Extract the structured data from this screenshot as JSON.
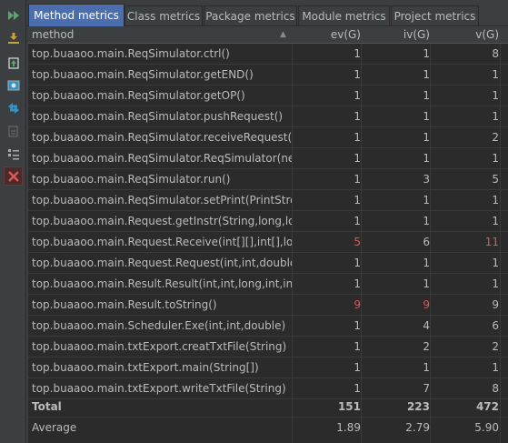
{
  "tabs": [
    {
      "label": "Method metrics",
      "active": true
    },
    {
      "label": "Class metrics",
      "active": false
    },
    {
      "label": "Package metrics",
      "active": false
    },
    {
      "label": "Module metrics",
      "active": false
    },
    {
      "label": "Project metrics",
      "active": false
    }
  ],
  "toolbar": {
    "icons": [
      "run-icon",
      "export-icon",
      "open-file-icon",
      "snapshot-icon",
      "diff-icon",
      "settings-icon",
      "layout-icon",
      "close-icon"
    ]
  },
  "columns": {
    "method": "method",
    "ev": "ev(G)",
    "iv": "iv(G)",
    "v": "v(G)",
    "sort_indicator": "▲"
  },
  "rows": [
    {
      "method": "top.buaaoo.main.ReqSimulator.ctrl()",
      "ev": "1",
      "iv": "1",
      "v": "8"
    },
    {
      "method": "top.buaaoo.main.ReqSimulator.getEND()",
      "ev": "1",
      "iv": "1",
      "v": "1"
    },
    {
      "method": "top.buaaoo.main.ReqSimulator.getOP()",
      "ev": "1",
      "iv": "1",
      "v": "1"
    },
    {
      "method": "top.buaaoo.main.ReqSimulator.pushRequest()",
      "ev": "1",
      "iv": "1",
      "v": "1"
    },
    {
      "method": "top.buaaoo.main.ReqSimulator.receiveRequest(int",
      "ev": "1",
      "iv": "1",
      "v": "2"
    },
    {
      "method": "top.buaaoo.main.ReqSimulator.ReqSimulator(new",
      "ev": "1",
      "iv": "1",
      "v": "1"
    },
    {
      "method": "top.buaaoo.main.ReqSimulator.run()",
      "ev": "1",
      "iv": "3",
      "v": "5"
    },
    {
      "method": "top.buaaoo.main.ReqSimulator.setPrint(PrintStrea",
      "ev": "1",
      "iv": "1",
      "v": "1"
    },
    {
      "method": "top.buaaoo.main.Request.getInstr(String,long,lon",
      "ev": "1",
      "iv": "1",
      "v": "1"
    },
    {
      "method": "top.buaaoo.main.Request.Receive(int[][],int[],long",
      "ev": "5",
      "iv": "6",
      "v": "11",
      "ev_red": true,
      "v_red": true
    },
    {
      "method": "top.buaaoo.main.Request.Request(int,int,double,i",
      "ev": "1",
      "iv": "1",
      "v": "1"
    },
    {
      "method": "top.buaaoo.main.Result.Result(int,int,long,int,int,d",
      "ev": "1",
      "iv": "1",
      "v": "1"
    },
    {
      "method": "top.buaaoo.main.Result.toString()",
      "ev": "9",
      "iv": "9",
      "v": "9",
      "ev_red": true,
      "iv_red": true
    },
    {
      "method": "top.buaaoo.main.Scheduler.Exe(int,int,double)",
      "ev": "1",
      "iv": "4",
      "v": "6"
    },
    {
      "method": "top.buaaoo.main.txtExport.creatTxtFile(String)",
      "ev": "1",
      "iv": "2",
      "v": "2"
    },
    {
      "method": "top.buaaoo.main.txtExport.main(String[])",
      "ev": "1",
      "iv": "1",
      "v": "1"
    },
    {
      "method": "top.buaaoo.main.txtExport.writeTxtFile(String)",
      "ev": "1",
      "iv": "7",
      "v": "8"
    }
  ],
  "total": {
    "label": "Total",
    "ev": "151",
    "iv": "223",
    "v": "472"
  },
  "average": {
    "label": "Average",
    "ev": "1.89",
    "iv": "2.79",
    "v": "5.90"
  },
  "colors": {
    "active_tab": "#4b6eaf",
    "highlight_red": "#e05555",
    "background": "#2b2b2b",
    "panel": "#3c3f41"
  }
}
